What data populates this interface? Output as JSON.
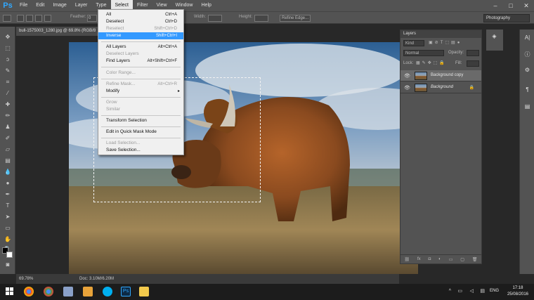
{
  "app": {
    "logo": "Ps"
  },
  "menu": [
    "File",
    "Edit",
    "Image",
    "Layer",
    "Type",
    "Select",
    "Filter",
    "View",
    "Window",
    "Help"
  ],
  "menu_active": "Select",
  "window_controls": [
    "–",
    "□",
    "✕"
  ],
  "options": {
    "feather_label": "Feather:",
    "feather_value": "0 px",
    "width_label": "Width:",
    "height_label": "Height:",
    "refine_label": "Refine Edge...",
    "workspace": "Photography"
  },
  "document": {
    "tab_title": "bull-1575003_1280.jpg @ 69.8% (RGB/8"
  },
  "status": {
    "zoom": "69.78%",
    "doc": "Doc: 3.10M/6.20M"
  },
  "select_menu": [
    {
      "label": "All",
      "shortcut": "Ctrl+A",
      "disabled": false
    },
    {
      "label": "Deselect",
      "shortcut": "Ctrl+D",
      "disabled": false
    },
    {
      "label": "Reselect",
      "shortcut": "Shift+Ctrl+D",
      "disabled": true
    },
    {
      "label": "Inverse",
      "shortcut": "Shift+Ctrl+I",
      "disabled": false,
      "highlighted": true
    },
    {
      "label": "All Layers",
      "shortcut": "Alt+Ctrl+A",
      "disabled": false
    },
    {
      "label": "Deselect Layers",
      "shortcut": "",
      "disabled": true
    },
    {
      "label": "Find Layers",
      "shortcut": "Alt+Shift+Ctrl+F",
      "disabled": false
    },
    {
      "label": "Color Range...",
      "shortcut": "",
      "disabled": true
    },
    {
      "label": "Refine Mask...",
      "shortcut": "Alt+Ctrl+R",
      "disabled": true
    },
    {
      "label": "Modify",
      "shortcut": "",
      "disabled": false,
      "submenu": true
    },
    {
      "label": "Grow",
      "shortcut": "",
      "disabled": true
    },
    {
      "label": "Similar",
      "shortcut": "",
      "disabled": true
    },
    {
      "label": "Transform Selection",
      "shortcut": "",
      "disabled": false
    },
    {
      "label": "Edit in Quick Mask Mode",
      "shortcut": "",
      "disabled": false
    },
    {
      "label": "Load Selection...",
      "shortcut": "",
      "disabled": true
    },
    {
      "label": "Save Selection...",
      "shortcut": "",
      "disabled": false
    }
  ],
  "layers_panel": {
    "tab": "Layers",
    "filter_kind": "Kind",
    "blend_mode": "Normal",
    "opacity_label": "Opacity:",
    "lock_label": "Lock:",
    "fill_label": "Fill:",
    "layers": [
      {
        "name": "Background copy",
        "selected": true,
        "locked": false
      },
      {
        "name": "Background",
        "selected": false,
        "locked": true
      }
    ]
  },
  "taskbar": {
    "lang": "ENG",
    "time": "17:18",
    "date": "25/08/2016"
  },
  "colors": {
    "ui_panel": "#535353",
    "menu_highlight": "#3399ff",
    "ps_blue": "#31a8ff"
  }
}
